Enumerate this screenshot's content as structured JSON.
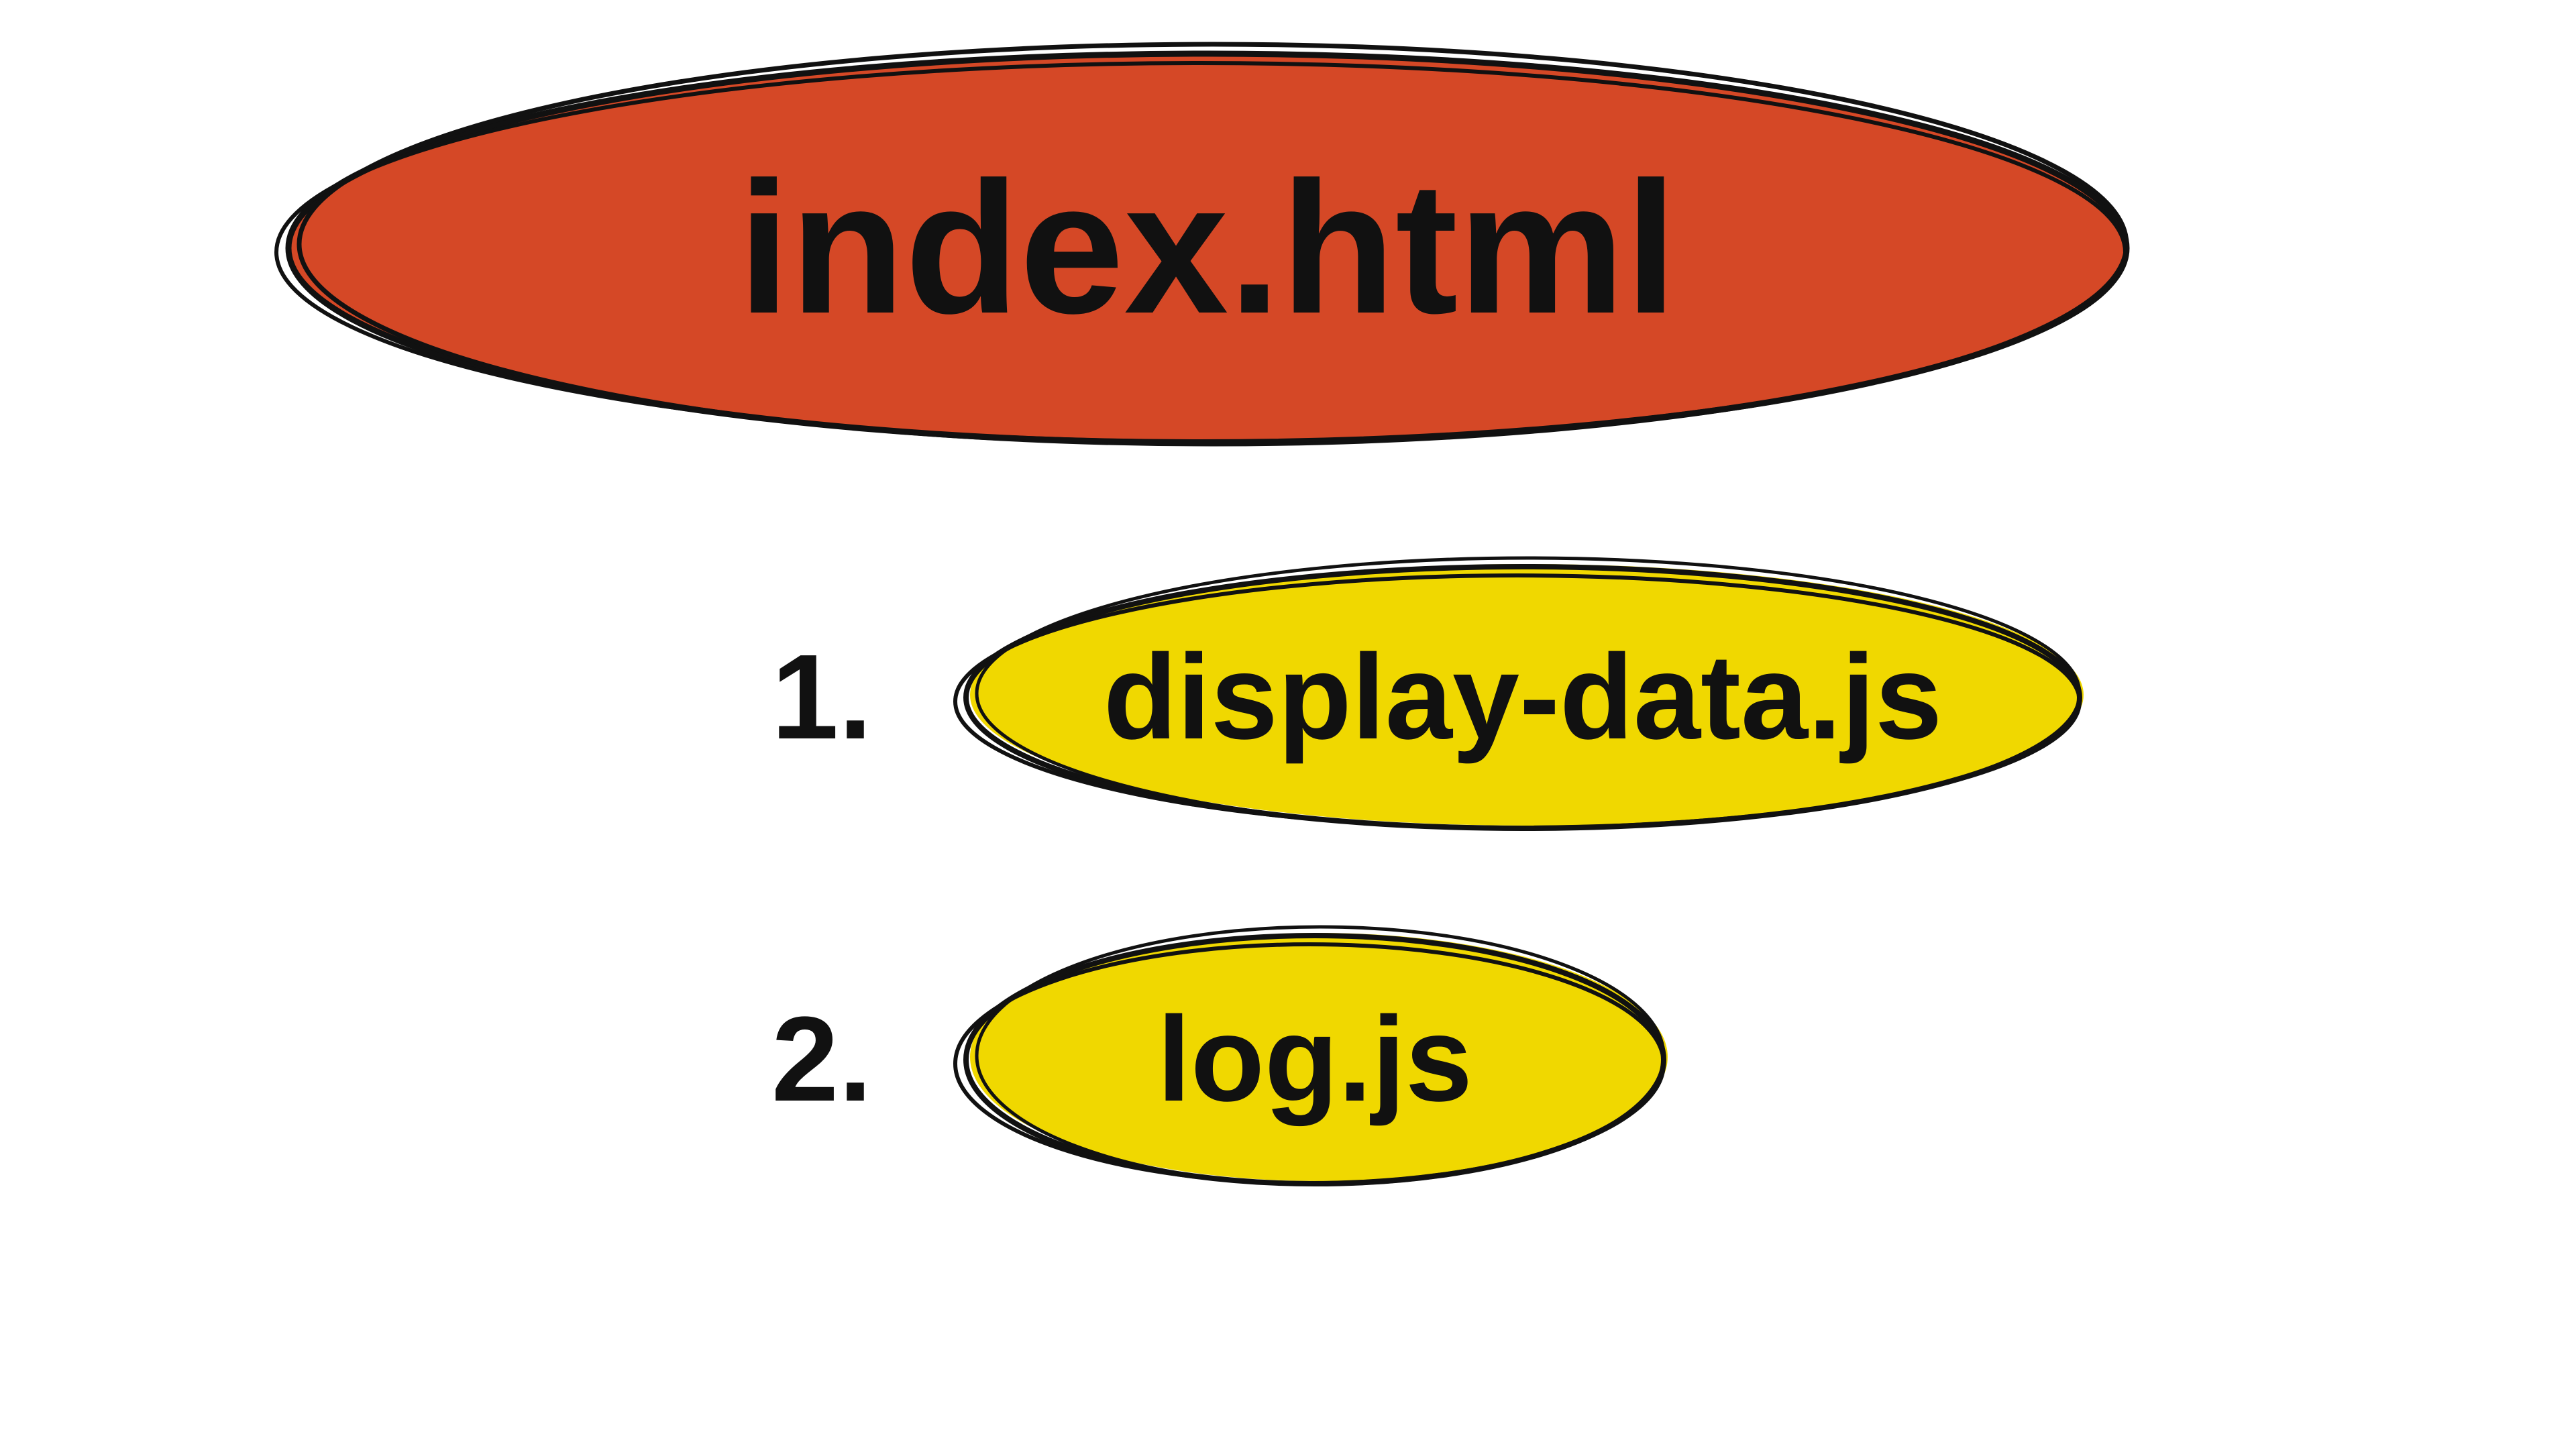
{
  "diagram": {
    "main": {
      "label": "index.html",
      "color": "#d54826"
    },
    "items": [
      {
        "num": "1.",
        "label": "display-data.js",
        "color": "#f0d800"
      },
      {
        "num": "2.",
        "label": "log.js",
        "color": "#f0d800"
      }
    ]
  }
}
